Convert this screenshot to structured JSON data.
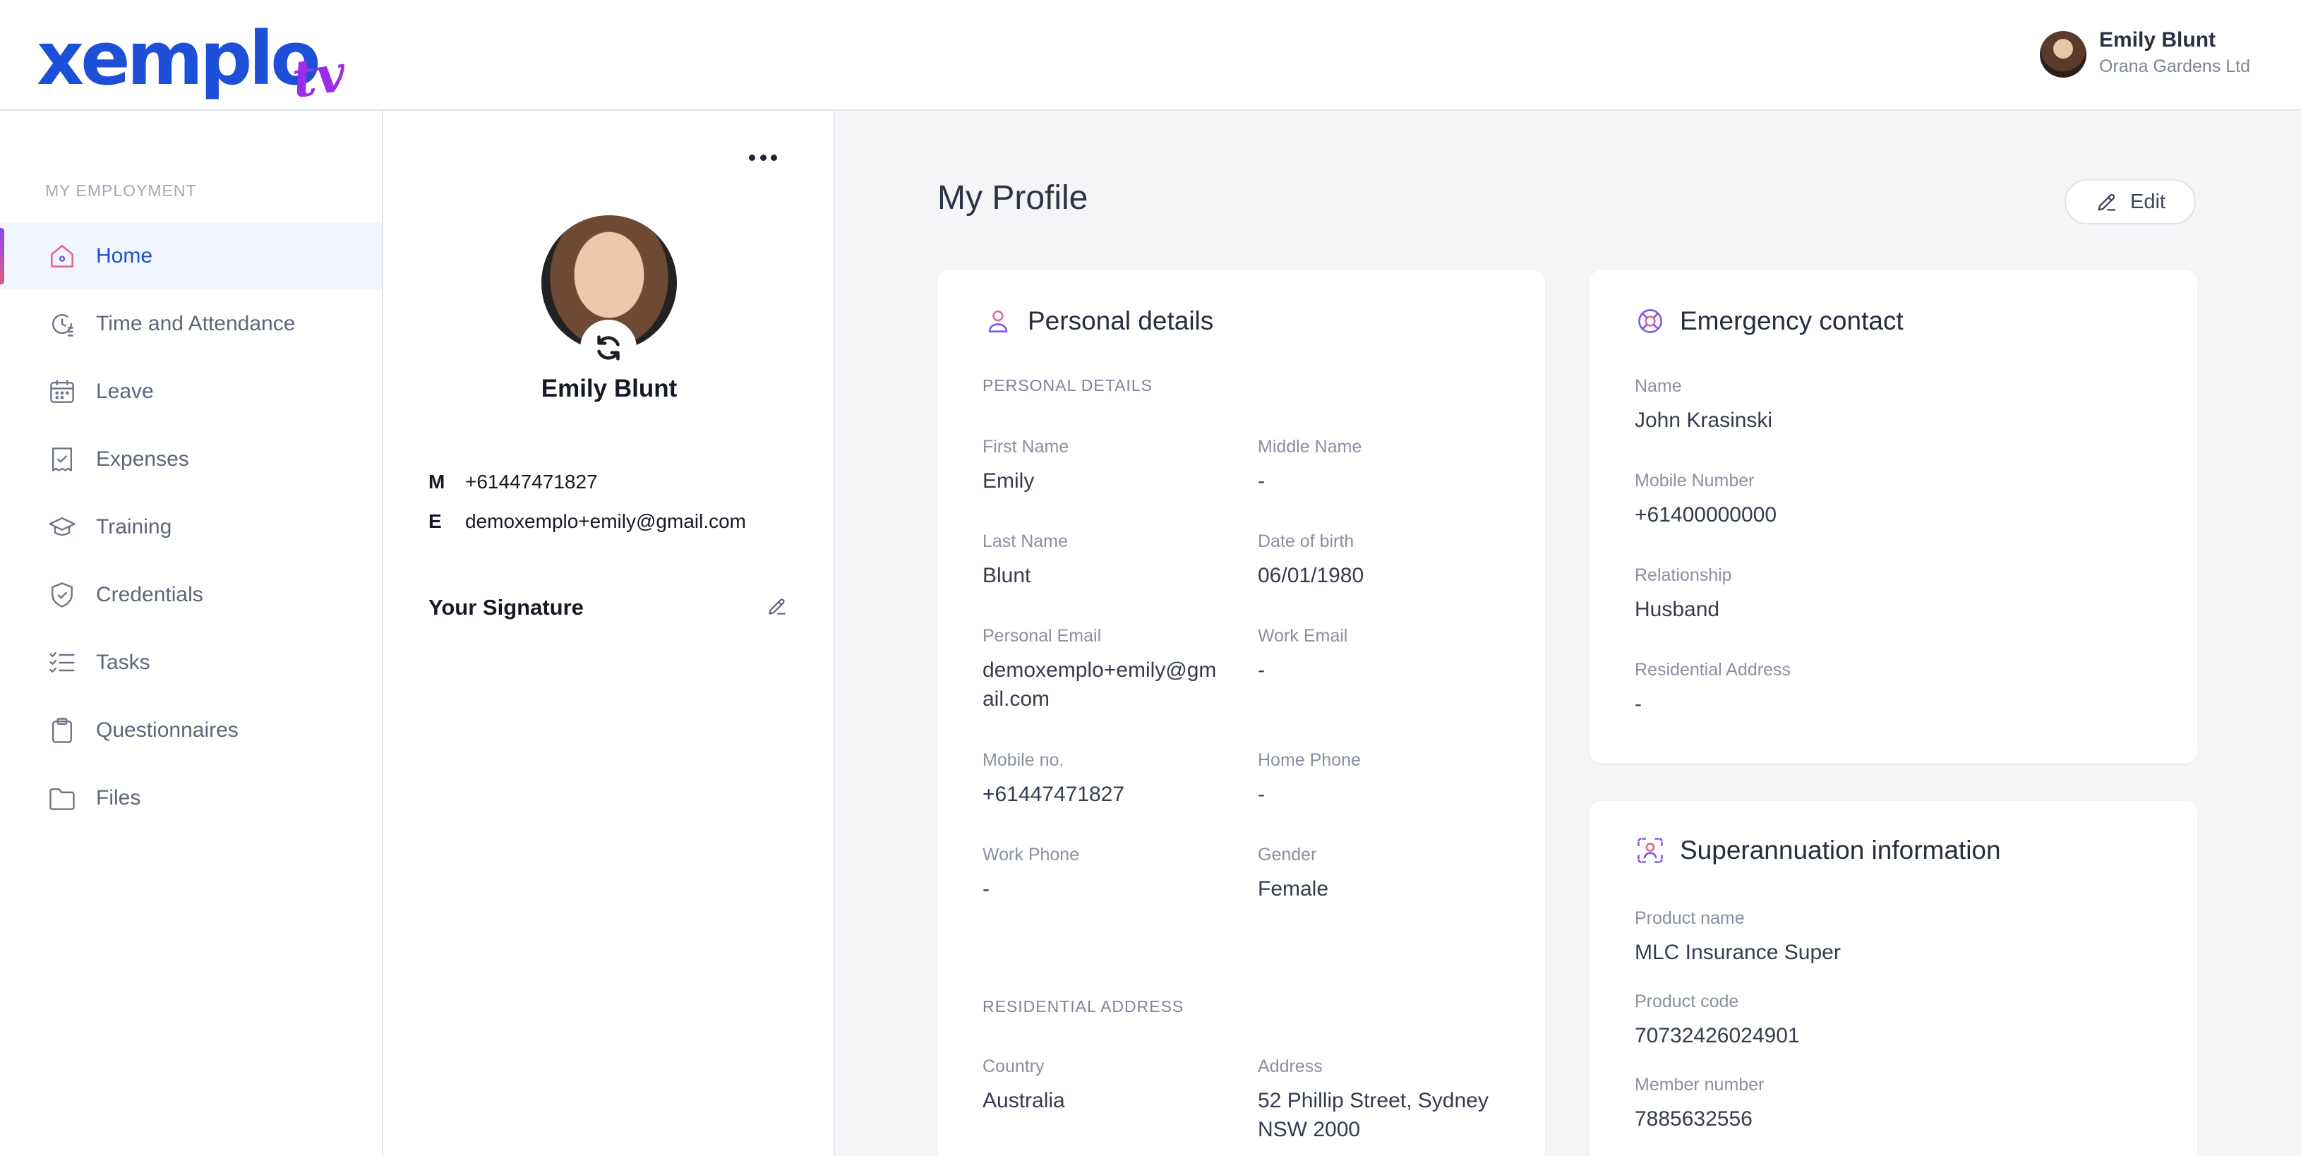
{
  "brand": {
    "name": "xemplo",
    "suffix": "tv"
  },
  "user": {
    "name": "Emily Blunt",
    "company": "Orana Gardens Ltd"
  },
  "sidebar": {
    "heading": "MY EMPLOYMENT",
    "items": [
      {
        "label": "Home",
        "icon": "home-icon",
        "active": true
      },
      {
        "label": "Time and Attendance",
        "icon": "clock-icon"
      },
      {
        "label": "Leave",
        "icon": "calendar-icon"
      },
      {
        "label": "Expenses",
        "icon": "receipt-icon"
      },
      {
        "label": "Training",
        "icon": "graduation-cap-icon"
      },
      {
        "label": "Credentials",
        "icon": "shield-check-icon"
      },
      {
        "label": "Tasks",
        "icon": "checklist-icon"
      },
      {
        "label": "Questionnaires",
        "icon": "clipboard-icon"
      },
      {
        "label": "Files",
        "icon": "folder-icon"
      }
    ]
  },
  "profile": {
    "name": "Emily Blunt",
    "mobile_key": "M",
    "mobile": "+61447471827",
    "email_key": "E",
    "email": "demoxemplo+emily@gmail.com",
    "signature_title": "Your Signature"
  },
  "main": {
    "title": "My Profile",
    "edit_label": "Edit"
  },
  "personal": {
    "title": "Personal details",
    "section": "PERSONAL DETAILS",
    "first_name": {
      "label": "First Name",
      "value": "Emily"
    },
    "middle_name": {
      "label": "Middle Name",
      "value": "-"
    },
    "last_name": {
      "label": "Last Name",
      "value": "Blunt"
    },
    "dob": {
      "label": "Date of birth",
      "value": "06/01/1980"
    },
    "personal_email": {
      "label": "Personal Email",
      "value": "demoxemplo+emily@gmail.com"
    },
    "work_email": {
      "label": "Work Email",
      "value": "-"
    },
    "mobile": {
      "label": "Mobile no.",
      "value": "+61447471827"
    },
    "home_phone": {
      "label": "Home Phone",
      "value": "-"
    },
    "work_phone": {
      "label": "Work Phone",
      "value": "-"
    },
    "gender": {
      "label": "Gender",
      "value": "Female"
    },
    "address_section": "RESIDENTIAL ADDRESS",
    "country": {
      "label": "Country",
      "value": "Australia"
    },
    "address": {
      "label": "Address",
      "value": "52 Phillip Street, Sydney NSW 2000"
    }
  },
  "emergency": {
    "title": "Emergency contact",
    "name": {
      "label": "Name",
      "value": "John Krasinski"
    },
    "mobile": {
      "label": "Mobile Number",
      "value": "+61400000000"
    },
    "relationship": {
      "label": "Relationship",
      "value": "Husband"
    },
    "address": {
      "label": "Residential Address",
      "value": "-"
    }
  },
  "super": {
    "title": "Superannuation information",
    "product_name": {
      "label": "Product name",
      "value": "MLC Insurance Super"
    },
    "product_code": {
      "label": "Product code",
      "value": "70732426024901"
    },
    "member_number": {
      "label": "Member number",
      "value": "7885632556"
    }
  },
  "colors": {
    "brand_blue": "#1e4fd8",
    "brand_purple": "#9a2ee8",
    "active_nav_bg": "#f1f5fd",
    "main_bg": "#f5f5f7"
  }
}
